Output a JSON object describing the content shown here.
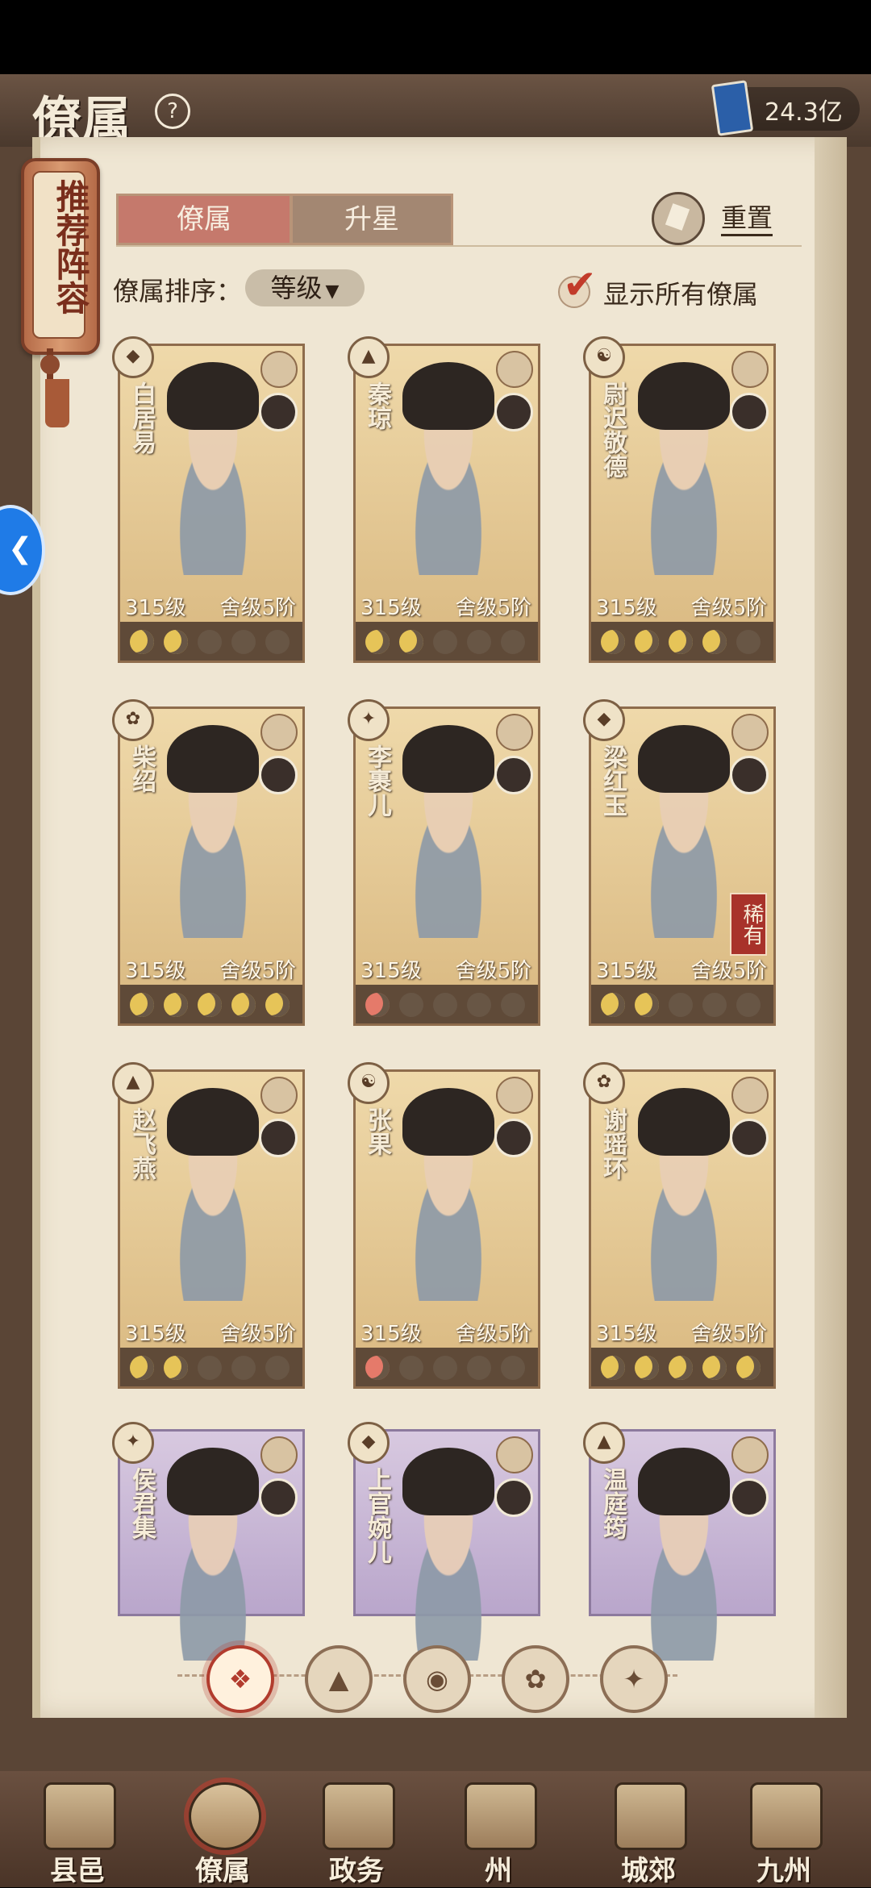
{
  "header": {
    "title": "僚属",
    "help_symbol": "?",
    "currency_value": "24.3亿"
  },
  "side_tag": {
    "label": "推荐阵容"
  },
  "tabs": [
    {
      "label": "僚属",
      "active": true
    },
    {
      "label": "升星",
      "active": false
    }
  ],
  "reset_label": "重置",
  "sort": {
    "label": "僚属排序：",
    "value": "等级"
  },
  "show_all": {
    "label": "显示所有僚属",
    "checked": true
  },
  "cards": [
    {
      "name": "白居易",
      "level": "315级",
      "rank": "舍级5阶",
      "moons": [
        "on",
        "on",
        "off",
        "off",
        "off"
      ],
      "theme": "gold"
    },
    {
      "name": "秦琼",
      "level": "315级",
      "rank": "舍级5阶",
      "moons": [
        "on",
        "on",
        "off",
        "off",
        "off"
      ],
      "theme": "gold"
    },
    {
      "name": "尉迟敬德",
      "level": "315级",
      "rank": "舍级5阶",
      "moons": [
        "on",
        "on",
        "on",
        "on",
        "off"
      ],
      "theme": "gold"
    },
    {
      "name": "柴绍",
      "level": "315级",
      "rank": "舍级5阶",
      "moons": [
        "on",
        "on",
        "on",
        "on",
        "on"
      ],
      "theme": "gold"
    },
    {
      "name": "李裹儿",
      "level": "315级",
      "rank": "舍级5阶",
      "moons": [
        "red",
        "off",
        "off",
        "off",
        "off"
      ],
      "theme": "gold"
    },
    {
      "name": "梁红玉",
      "level": "315级",
      "rank": "舍级5阶",
      "moons": [
        "on",
        "on",
        "off",
        "off",
        "off"
      ],
      "theme": "gold",
      "badge": "稀有"
    },
    {
      "name": "赵飞燕",
      "level": "315级",
      "rank": "舍级5阶",
      "moons": [
        "on",
        "on",
        "off",
        "off",
        "off"
      ],
      "theme": "gold"
    },
    {
      "name": "张果",
      "level": "315级",
      "rank": "舍级5阶",
      "moons": [
        "red",
        "off",
        "off",
        "off",
        "off"
      ],
      "theme": "gold"
    },
    {
      "name": "谢瑶环",
      "level": "315级",
      "rank": "舍级5阶",
      "moons": [
        "on",
        "on",
        "on",
        "on",
        "on"
      ],
      "theme": "gold"
    },
    {
      "name": "侯君集",
      "theme": "purple"
    },
    {
      "name": "上官婉儿",
      "theme": "purple"
    },
    {
      "name": "温庭筠",
      "theme": "purple"
    }
  ],
  "filters": [
    "all-icon",
    "mountain-icon",
    "gourd-icon",
    "fan-icon",
    "beast-icon"
  ],
  "bottom_nav": [
    {
      "label": "县邑",
      "active": false
    },
    {
      "label": "僚属",
      "active": true
    },
    {
      "label": "政务",
      "active": false
    },
    {
      "label": "州",
      "active": false
    },
    {
      "label": "城郊",
      "active": false
    },
    {
      "label": "九州",
      "active": false
    }
  ],
  "colors": {
    "accent_red": "#c5796c",
    "moon_gold": "#e6c458",
    "card_gold": "#efd9aa",
    "card_purple": "#d8c9e0",
    "page": "#efe6d3"
  }
}
